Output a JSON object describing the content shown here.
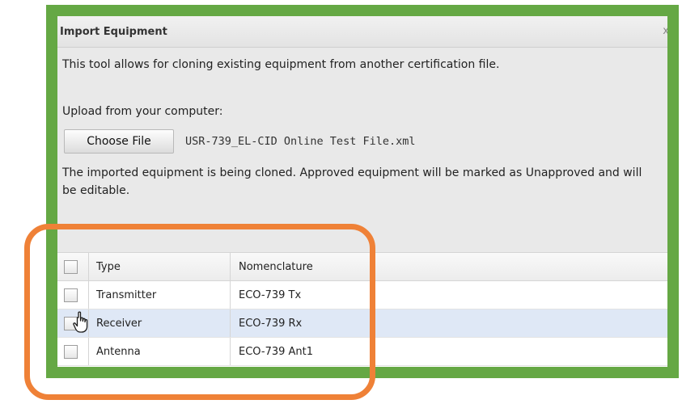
{
  "dialog": {
    "title": "Import Equipment",
    "close_glyph": "x",
    "intro": "This tool allows for cloning existing equipment from another certification file.",
    "upload_label": "Upload from your computer:",
    "choose_file_label": "Choose File",
    "file_name": "USR-739_EL-CID Online Test File.xml",
    "status": "The imported equipment is being cloned. Approved equipment will be marked as Unapproved and will be editable."
  },
  "grid": {
    "columns": [
      "Type",
      "Nomenclature"
    ],
    "rows": [
      {
        "type": "Transmitter",
        "nomenclature": "ECO-739 Tx",
        "selected": false
      },
      {
        "type": "Receiver",
        "nomenclature": "ECO-739 Rx",
        "selected": true
      },
      {
        "type": "Antenna",
        "nomenclature": "ECO-739 Ant1",
        "selected": false
      }
    ]
  },
  "colors": {
    "green_frame": "#65a844",
    "orange_highlight": "#ef8137",
    "selected_row": "#dfe8f6"
  },
  "icons": {
    "cursor": "hand-pointer-icon",
    "close": "close-icon"
  }
}
